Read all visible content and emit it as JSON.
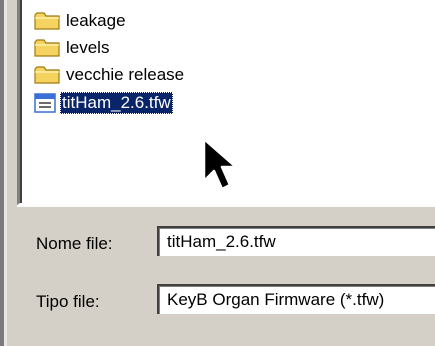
{
  "file_list": {
    "items": [
      {
        "label": "leakage",
        "icon": "folder-icon"
      },
      {
        "label": "levels",
        "icon": "folder-icon"
      },
      {
        "label": "vecchie release",
        "icon": "folder-icon"
      },
      {
        "label": "titHam_2.6.tfw",
        "icon": "file-icon",
        "selected": true
      }
    ]
  },
  "form": {
    "filename_label": "Nome file:",
    "filename_value": "titHam_2.6.tfw",
    "filetype_label": "Tipo file:",
    "filetype_value": "KeyB Organ Firmware (*.tfw)"
  },
  "colors": {
    "dialog_bg": "#d4d0c8",
    "selection": "#0a246a",
    "folder": "#f4d35e"
  }
}
